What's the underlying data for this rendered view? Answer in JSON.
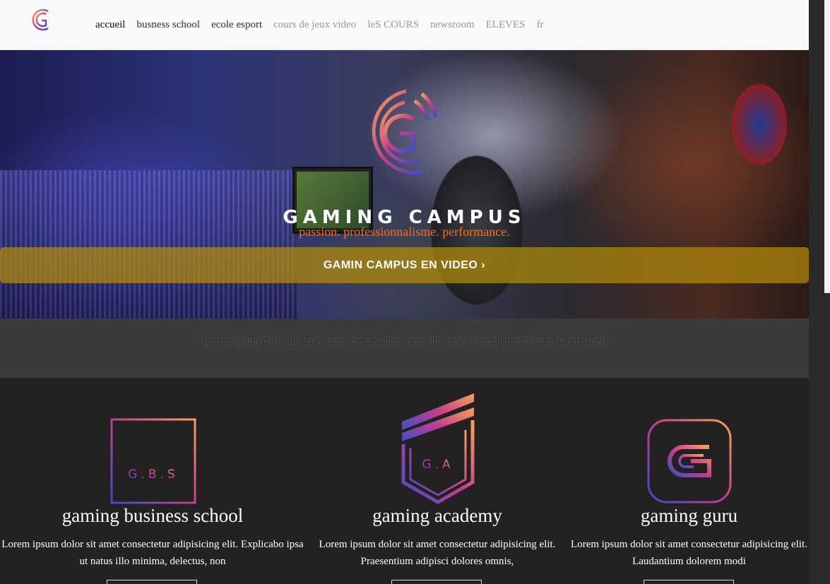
{
  "nav": {
    "links": [
      "accueil",
      "busness school",
      "ecole esport",
      "cours de jeux video",
      "leS COURS",
      "newsroom",
      "ELEVES",
      "fr"
    ]
  },
  "hero": {
    "title": "GAMING CAMPUS",
    "slogan": "passion. professionnalisme. performance.",
    "cta_label": "GAMIN CAMPUS EN VIDEO ›"
  },
  "intro": {
    "text": "Lorem ipsum dolor sit, amet consectetur adipisicing elit. Esse voluptatem dolorem, facere fugi."
  },
  "schools": [
    {
      "logo_text": "G.B.S",
      "title": "gaming business school",
      "desc": "Lorem ipsum dolor sit amet consectetur adipisicing elit. Explicabo ipsa ut natus illo minima, delectus, non"
    },
    {
      "logo_text": "G.A",
      "title": "gaming academy",
      "desc": "Lorem ipsum dolor sit amet consectetur adipisicing elit. Praesentium adipisci dolores omnis,"
    },
    {
      "logo_text": "",
      "title": "gaming guru",
      "desc": "Lorem ipsum dolor sit amet consectetur adipisicing elit. Laudantium dolorem modi"
    }
  ],
  "colors": {
    "accent_orange": "#ff6a13",
    "gradient_start": "#f7a25a",
    "gradient_mid": "#c43e8e",
    "gradient_end": "#3b4fc8",
    "cta_bg": "#b48c0a"
  }
}
